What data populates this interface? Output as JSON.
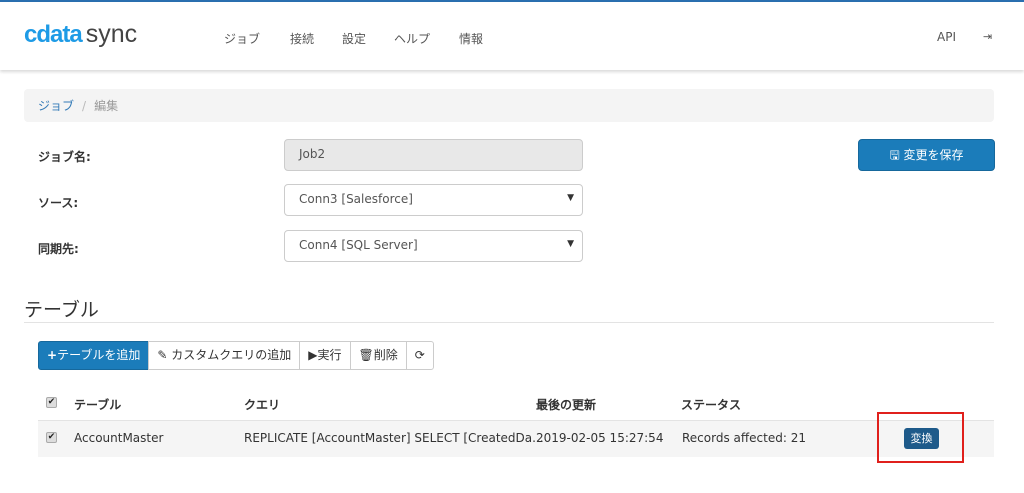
{
  "header": {
    "logo_prefix": "cdata",
    "logo_suffix": "sync",
    "nav": [
      "ジョブ",
      "接続",
      "設定",
      "ヘルプ",
      "情報"
    ],
    "api": "API",
    "logout_icon": "sign-out-icon"
  },
  "breadcrumb": {
    "parent": "ジョブ",
    "separator": "/",
    "current": "編集"
  },
  "form": {
    "job_name_label": "ジョブ名:",
    "job_name_value": "Job2",
    "source_label": "ソース:",
    "source_value": "Conn3 [Salesforce]",
    "dest_label": "同期先:",
    "dest_value": "Conn4 [SQL Server]",
    "save_label": "変更を保存"
  },
  "tables": {
    "heading": "テーブル",
    "buttons": {
      "add_table": "テーブルを追加",
      "add_query": "カスタムクエリの追加",
      "run": "実行",
      "delete": "削除"
    },
    "columns": [
      "テーブル",
      "クエリ",
      "最後の更新",
      "ステータス"
    ],
    "rows": [
      {
        "table": "AccountMaster",
        "query": "REPLICATE [AccountMaster] SELECT [CreatedDa...",
        "updated": "2019-02-05 15:27:54",
        "status": "Records affected: 21",
        "action": "変換"
      }
    ]
  }
}
